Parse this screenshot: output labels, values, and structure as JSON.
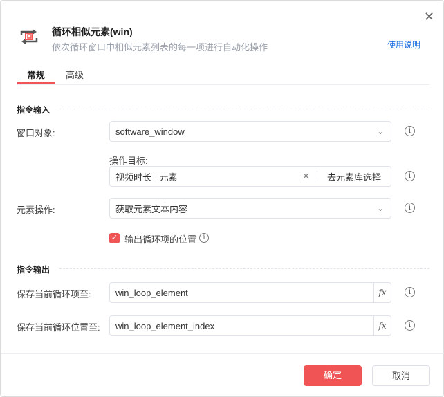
{
  "header": {
    "title": "循环相似元素(win)",
    "subtitle": "依次循环窗口中相似元素列表的每一项进行自动化操作",
    "help_link": "使用说明",
    "close": "✕"
  },
  "tabs": [
    {
      "label": "常规",
      "active": true
    },
    {
      "label": "高级",
      "active": false
    }
  ],
  "input_section": {
    "title": "指令输入",
    "window_label": "窗口对象:",
    "window_value": "software_window",
    "target_label": "操作目标:",
    "target_value": "视频时长 - 元素",
    "target_pick": "去元素库选择",
    "op_label": "元素操作:",
    "op_value": "获取元素文本内容",
    "checkbox_label": "输出循环项的位置",
    "checkbox_checked": true
  },
  "output_section": {
    "title": "指令输出",
    "item_label": "保存当前循环项至:",
    "item_value": "win_loop_element",
    "index_label": "保存当前循环位置至:",
    "index_value": "win_loop_element_index",
    "fx": "fx"
  },
  "footer": {
    "confirm": "确定",
    "cancel": "取消"
  },
  "colors": {
    "accent": "#f05454",
    "link": "#1f6fe0"
  }
}
